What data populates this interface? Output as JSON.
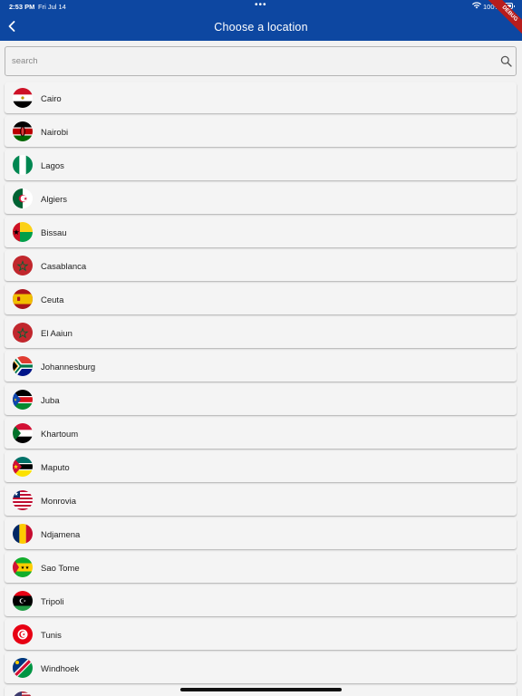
{
  "status_bar": {
    "time": "2:53 PM",
    "date": "Fri Jul 14",
    "battery": "100%"
  },
  "header": {
    "title": "Choose a location",
    "debug_banner": "DEBUG",
    "accent": "#0d47a1"
  },
  "search": {
    "placeholder": "search",
    "value": ""
  },
  "locations": [
    {
      "name": "Cairo",
      "flag": "egypt-flag-icon"
    },
    {
      "name": "Nairobi",
      "flag": "kenya-flag-icon"
    },
    {
      "name": "Lagos",
      "flag": "nigeria-flag-icon"
    },
    {
      "name": "Algiers",
      "flag": "algeria-flag-icon"
    },
    {
      "name": "Bissau",
      "flag": "guinea-bissau-flag-icon"
    },
    {
      "name": "Casablanca",
      "flag": "morocco-flag-icon"
    },
    {
      "name": "Ceuta",
      "flag": "spain-flag-icon"
    },
    {
      "name": "El Aaiun",
      "flag": "morocco-flag-icon"
    },
    {
      "name": "Johannesburg",
      "flag": "south-africa-flag-icon"
    },
    {
      "name": "Juba",
      "flag": "south-sudan-flag-icon"
    },
    {
      "name": "Khartoum",
      "flag": "sudan-flag-icon"
    },
    {
      "name": "Maputo",
      "flag": "mozambique-flag-icon"
    },
    {
      "name": "Monrovia",
      "flag": "liberia-flag-icon"
    },
    {
      "name": "Ndjamena",
      "flag": "chad-flag-icon"
    },
    {
      "name": "Sao Tome",
      "flag": "sao-tome-flag-icon"
    },
    {
      "name": "Tripoli",
      "flag": "libya-flag-icon"
    },
    {
      "name": "Tunis",
      "flag": "tunisia-flag-icon"
    },
    {
      "name": "Windhoek",
      "flag": "namibia-flag-icon"
    },
    {
      "name": "",
      "flag": "usa-flag-icon"
    }
  ]
}
